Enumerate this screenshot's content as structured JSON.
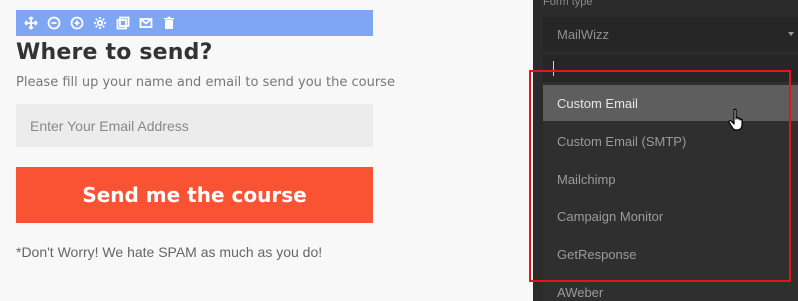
{
  "editor": {
    "toolbar": {
      "icons": [
        "move-icon",
        "minus-circle-icon",
        "plus-circle-icon",
        "gear-icon",
        "copy-icon",
        "mail-icon",
        "trash-icon"
      ]
    },
    "heading": "Where to send?",
    "subtext": "Please fill up your name and email to send you the course",
    "email_input": {
      "placeholder": "Enter Your Email Address",
      "value": ""
    },
    "submit_label": "Send me the course",
    "note": "*Don't Worry! We hate SPAM as much as you do!",
    "colors": {
      "toolbar": "#7ea6f2",
      "button": "#fa5334"
    }
  },
  "panel": {
    "label": "Form type",
    "selected": "MailWizz",
    "search_value": "",
    "options": [
      {
        "label": "Custom Email",
        "active": true
      },
      {
        "label": "Custom Email (SMTP)",
        "active": false
      },
      {
        "label": "Mailchimp",
        "active": false
      },
      {
        "label": "Campaign Monitor",
        "active": false
      },
      {
        "label": "GetResponse",
        "active": false
      },
      {
        "label": "AWeber",
        "active": false
      }
    ],
    "colors": {
      "highlight": "#e2141c",
      "active_option": "#5e5e5e"
    }
  }
}
